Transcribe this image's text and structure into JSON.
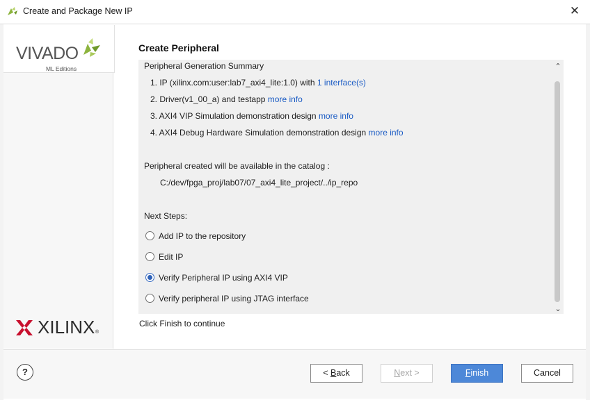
{
  "window": {
    "title": "Create and Package New IP",
    "close_icon": "close-icon"
  },
  "branding": {
    "vivado": "VIVADO",
    "vivado_edition": "ML Editions",
    "xilinx": "XILINX",
    "xilinx_reg": "®",
    "leaf_color": "#8db43e"
  },
  "page": {
    "title": "Create Peripheral"
  },
  "summary": {
    "heading": "Peripheral Generation Summary",
    "items": [
      {
        "text": "1. IP (xilinx.com:user:lab7_axi4_lite:1.0) with",
        "link": "1 interface(s)"
      },
      {
        "text": "2. Driver(v1_00_a) and testapp",
        "link": "more info"
      },
      {
        "text": "3. AXI4 VIP Simulation demonstration design",
        "link": "more info"
      },
      {
        "text": "4. AXI4 Debug Hardware Simulation demonstration design",
        "link": "more info"
      }
    ],
    "catalog_label": "Peripheral created will be available in the catalog :",
    "catalog_path": "C:/dev/fpga_proj/lab07/07_axi4_lite_project/../ip_repo"
  },
  "next_steps": {
    "label": "Next Steps:",
    "options": [
      {
        "label": "Add IP to the repository",
        "checked": false
      },
      {
        "label": "Edit IP",
        "checked": false
      },
      {
        "label": "Verify Peripheral IP using AXI4 VIP",
        "checked": true
      },
      {
        "label": "Verify peripheral IP using JTAG interface",
        "checked": false
      }
    ]
  },
  "footer_message": "Click Finish to continue",
  "buttons": {
    "help": "?",
    "back_prefix": "< ",
    "back_u": "B",
    "back_rest": "ack",
    "next_u": "N",
    "next_rest": "ext >",
    "finish_u": "F",
    "finish_rest": "inish",
    "cancel": "Cancel"
  },
  "colors": {
    "accent": "#4d88d8",
    "link": "#1a5bc4"
  }
}
